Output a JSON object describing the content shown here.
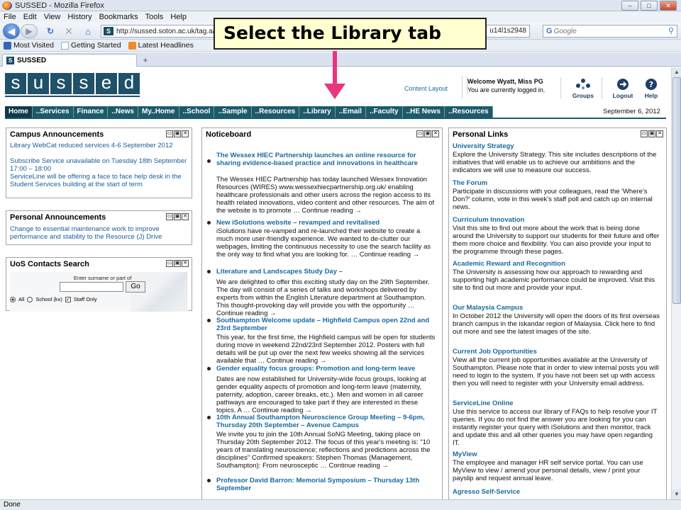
{
  "window": {
    "title": "SUSSED - Mozilla Firefox",
    "controls": {
      "minimize": "–",
      "maximize": "□",
      "close": "✕"
    }
  },
  "menu": [
    "File",
    "Edit",
    "View",
    "History",
    "Bookmarks",
    "Tools",
    "Help"
  ],
  "toolbar": {
    "back_icon": "back-arrow-icon",
    "forward_icon": "forward-arrow-icon",
    "reload_icon": "reload-icon",
    "stop_icon": "stop-icon",
    "home_icon": "home-icon",
    "url": "http://sussed.soton.ac.uk/tag.aaa4",
    "url_tail": "u14l1s2948",
    "search_placeholder": "Google",
    "search_engine_icon": "google-icon"
  },
  "bookmarks": [
    "Most Visited",
    "Getting Started",
    "Latest Headlines"
  ],
  "tab": {
    "label": "SUSSED",
    "new_tab": "+"
  },
  "status": "Done",
  "header": {
    "logo_letters": [
      "s",
      "u",
      "s",
      "s",
      "e",
      "d"
    ],
    "content_layout": "Content Layout",
    "welcome": "Welcome Wyatt, Miss PG",
    "logged_in": "You are currently logged in.",
    "groups": "Groups",
    "logout": "Logout",
    "help": "Help",
    "date": "September 6, 2012"
  },
  "nav_tabs": [
    "Home",
    "..Services",
    "Finance",
    "..News",
    "My..Home",
    "..School",
    "..Sample",
    "..Resources",
    "..Library",
    "..Email",
    "..Faculty",
    "..HE News",
    "..Resources"
  ],
  "campus": {
    "title": "Campus Announcements",
    "items": [
      "Library WebCat reduced services 4-6 September 2012",
      "Subscribe Service unavailable on Tuesday 18th September 17:00 – 18:00",
      "ServiceLine will be offering a face to face help desk in the Student Services building at the start of term"
    ]
  },
  "personal_ann": {
    "title": "Personal Announcements",
    "items": [
      "Change to essential maintenance work to improve performance and stability to the Resource (J) Drive"
    ]
  },
  "contacts": {
    "title": "UoS Contacts Search",
    "label": "Enter surname or part of",
    "go": "Go",
    "options": [
      "All",
      "School (kx)",
      "Staff Only"
    ]
  },
  "noticeboard": {
    "title": "Noticeboard",
    "more": "Continue reading →",
    "items": [
      {
        "title": "The Wessex HIEC Partnership launches an online resource for sharing evidence-based practice and innovations in healthcare",
        "body": "The Wessex HIEC Partnership has today launched Wessex Innovation Resources (WIRES) www.wessexhiecpartnership.org.uk/ enabling healthcare professionals and other users across the region access to its health related innovations, video content and other resources. The aim of the website is to promote …"
      },
      {
        "title": "New iSolutions website – revamped and revitalised",
        "body": "iSolutions have re-vamped and re-launched their website to create a much more user-friendly experience. We wanted to de-clutter our webpages, limiting the continuous necessity to use the search facility as the only way to find what you are looking for. …"
      },
      {
        "title": "Literature and Landscapes Study Day –",
        "body": "We are delighted to offer this exciting study day on the 29th September. The day will consist of a series of talks and workshops delivered by experts from within the English Literature department at Southampton. This thought-provoking day will provide you with the opportunity …"
      },
      {
        "title": "Southampton Welcome update – Highfield Campus open 22nd and 23rd September",
        "body": "This year, for the first time, the Highfield campus will be open for students during move in weekend 22nd/23rd September 2012. Posters with full details will be put up over the next few weeks showing all the services available that …"
      },
      {
        "title": "Gender equality focus groups: Promotion and long-term leave",
        "body": "Dates are now established for University-wide focus groups, looking at gender equality aspects of promotion and long-term leave (maternity, paternity, adoption, career breaks, etc.). Men and women in all career pathways are encouraged to take part if they are interested in these topics. A …"
      },
      {
        "title": "10th Annual Southampton Neuroscience Group Meeting – 9-6pm, Thursday 20th September – Avenue Campus",
        "body": "We invite you to join the 10th Annual SoNG Meeting, taking place on Thursday 20th September 2012. The focus of this year's meeting is: \"10 years of translating neuroscience; reflections and predictions across the disciplines\" Confirmed speakers: Stephen Thomas (Management, Southampton): From neurosceptic …"
      },
      {
        "title": "Professor David Barron: Memorial Symposium – Thursday 13th September",
        "body": ""
      }
    ]
  },
  "personal_links": {
    "title": "Personal Links",
    "items": [
      {
        "title": "University Strategy",
        "body": "Explore the University Strategy. This site includes descriptions of the initiatives that will enable us to achieve our ambitions and the indicators we will use to measure our success."
      },
      {
        "title": "The Forum",
        "body": "Participate in discussions with your colleagues, read the 'Where's Don?' column, vote in this week's staff poll and catch up on internal news."
      },
      {
        "title": "Curriculum Innovation",
        "body": "Visit this site to find out more about the work that is being done around the University to support our students for their future and offer them more choice and flexibility. You can also provide your input to the programme through these pages."
      },
      {
        "title": "Academic Reward and Recognition",
        "body": "The University is assessing how our approach to rewarding and supporting high academic performance could be improved. Visit this site to find out more and provide your input."
      },
      {
        "title": "Our Malaysia Campus",
        "body": "In October 2012 the University will open the doors of its first overseas branch campus in the iskandar region of Malaysia. Click here to find out more and see the latest images of the site."
      },
      {
        "title": "Current Job Opportunities",
        "body": "View all the current job opportunities available at the University of Southampton. Please note that in order to view internal posts you will need to login to the system. If you have not been set up with access then you will need to register with your University email address."
      },
      {
        "title": "ServiceLine Online",
        "body": "Use this service to access our library of FAQs to help resolve your IT queries. If you do not find the answer you are looking for you can instantly register your query with iSolutions and then monitor, track and update this and all other queries you may have open regarding IT."
      },
      {
        "title": "MyView",
        "body": "The employee and manager HR self service portal. You can use MyView to view / amend your personal details, view / print your payslip and request annual leave."
      },
      {
        "title": "Agresso Self-Service",
        "body": ""
      }
    ]
  },
  "panel_buttons": [
    "▭",
    "▣",
    "✕"
  ],
  "annotation": {
    "text": "Select the Library tab",
    "arrow_color": "#e8357e"
  },
  "colors": {
    "nav": "#1d5a6a",
    "link": "#1a6aa0",
    "logo": "#1f5168"
  }
}
